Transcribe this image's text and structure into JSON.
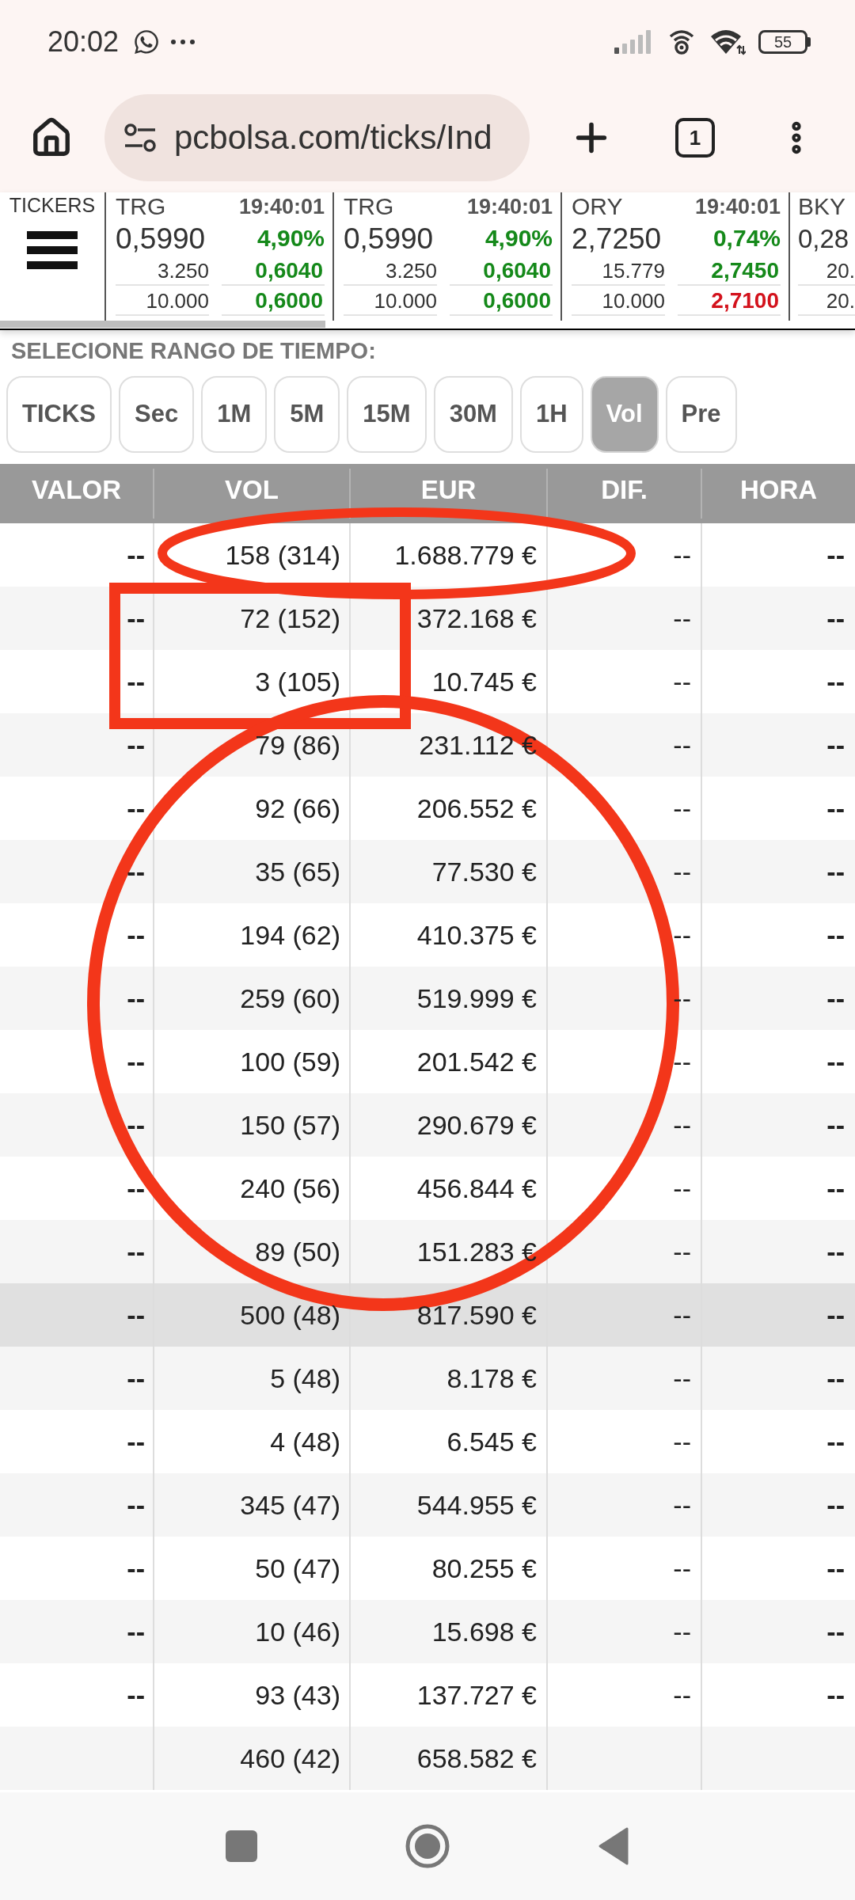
{
  "status_bar": {
    "time": "20:02",
    "battery": "55"
  },
  "browser": {
    "url": "pcbolsa.com/ticks/Ind",
    "tab_count": "1"
  },
  "ticker_strip": {
    "label": "TICKERS",
    "tickers": [
      {
        "symbol": "TRG",
        "time": "19:40:01",
        "price": "0,5990",
        "change": "4,90%",
        "change_up": true,
        "levels": [
          {
            "amount": "3.250",
            "price": "0,6040",
            "up": true
          },
          {
            "amount": "10.000",
            "price": "0,6000",
            "up": true
          }
        ]
      },
      {
        "symbol": "TRG",
        "time": "19:40:01",
        "price": "0,5990",
        "change": "4,90%",
        "change_up": true,
        "levels": [
          {
            "amount": "3.250",
            "price": "0,6040",
            "up": true
          },
          {
            "amount": "10.000",
            "price": "0,6000",
            "up": true
          }
        ]
      },
      {
        "symbol": "ORY",
        "time": "19:40:01",
        "price": "2,7250",
        "change": "0,74%",
        "change_up": true,
        "levels": [
          {
            "amount": "15.779",
            "price": "2,7450",
            "up": true
          },
          {
            "amount": "10.000",
            "price": "2,7100",
            "up": false
          }
        ]
      },
      {
        "symbol": "BKY",
        "price": "0,28",
        "levels": [
          {
            "amount": "20."
          },
          {
            "amount": "20."
          }
        ]
      }
    ]
  },
  "range_selector": {
    "label": "SELECIONE RANGO DE TIEMPO:",
    "options": [
      {
        "label": "TICKS",
        "selected": false
      },
      {
        "label": "Sec",
        "selected": false
      },
      {
        "label": "1M",
        "selected": false
      },
      {
        "label": "5M",
        "selected": false
      },
      {
        "label": "15M",
        "selected": false
      },
      {
        "label": "30M",
        "selected": false
      },
      {
        "label": "1H",
        "selected": false
      },
      {
        "label": "Vol",
        "selected": true
      },
      {
        "label": "Pre",
        "selected": false
      }
    ]
  },
  "table": {
    "columns": [
      "VALOR",
      "VOL",
      "EUR",
      "DIF.",
      "HORA"
    ],
    "rows": [
      {
        "valor": "--",
        "vol": "158 (314)",
        "eur": "1.688.779 €",
        "dif": "--",
        "hora": "--",
        "selected": false
      },
      {
        "valor": "--",
        "vol": "72 (152)",
        "eur": "372.168 €",
        "dif": "--",
        "hora": "--",
        "selected": false
      },
      {
        "valor": "--",
        "vol": "3 (105)",
        "eur": "10.745 €",
        "dif": "--",
        "hora": "--",
        "selected": false
      },
      {
        "valor": "--",
        "vol": "79 (86)",
        "eur": "231.112 €",
        "dif": "--",
        "hora": "--",
        "selected": false
      },
      {
        "valor": "--",
        "vol": "92 (66)",
        "eur": "206.552 €",
        "dif": "--",
        "hora": "--",
        "selected": false
      },
      {
        "valor": "--",
        "vol": "35 (65)",
        "eur": "77.530 €",
        "dif": "--",
        "hora": "--",
        "selected": false
      },
      {
        "valor": "--",
        "vol": "194 (62)",
        "eur": "410.375 €",
        "dif": "--",
        "hora": "--",
        "selected": false
      },
      {
        "valor": "--",
        "vol": "259 (60)",
        "eur": "519.999 €",
        "dif": "--",
        "hora": "--",
        "selected": false
      },
      {
        "valor": "--",
        "vol": "100 (59)",
        "eur": "201.542 €",
        "dif": "--",
        "hora": "--",
        "selected": false
      },
      {
        "valor": "--",
        "vol": "150 (57)",
        "eur": "290.679 €",
        "dif": "--",
        "hora": "--",
        "selected": false
      },
      {
        "valor": "--",
        "vol": "240 (56)",
        "eur": "456.844 €",
        "dif": "--",
        "hora": "--",
        "selected": false
      },
      {
        "valor": "--",
        "vol": "89 (50)",
        "eur": "151.283 €",
        "dif": "--",
        "hora": "--",
        "selected": false
      },
      {
        "valor": "--",
        "vol": "500 (48)",
        "eur": "817.590 €",
        "dif": "--",
        "hora": "--",
        "selected": true
      },
      {
        "valor": "--",
        "vol": "5 (48)",
        "eur": "8.178 €",
        "dif": "--",
        "hora": "--",
        "selected": false
      },
      {
        "valor": "--",
        "vol": "4 (48)",
        "eur": "6.545 €",
        "dif": "--",
        "hora": "--",
        "selected": false
      },
      {
        "valor": "--",
        "vol": "345 (47)",
        "eur": "544.955 €",
        "dif": "--",
        "hora": "--",
        "selected": false
      },
      {
        "valor": "--",
        "vol": "50 (47)",
        "eur": "80.255 €",
        "dif": "--",
        "hora": "--",
        "selected": false
      },
      {
        "valor": "--",
        "vol": "10 (46)",
        "eur": "15.698 €",
        "dif": "--",
        "hora": "--",
        "selected": false
      },
      {
        "valor": "--",
        "vol": "93 (43)",
        "eur": "137.727 €",
        "dif": "--",
        "hora": "--",
        "selected": false
      },
      {
        "vol": "460 (42)",
        "eur": "658.582 €",
        "selected": false
      }
    ]
  }
}
